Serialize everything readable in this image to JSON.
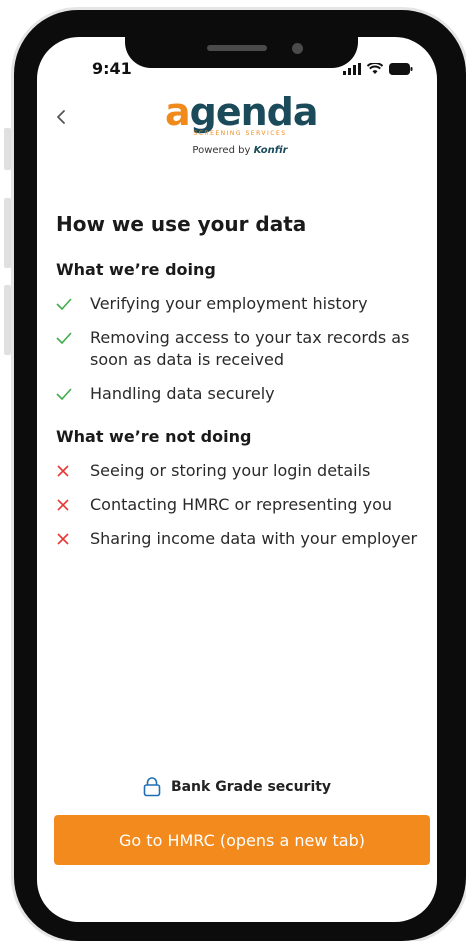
{
  "status_bar": {
    "time": "9:41"
  },
  "header": {
    "logo_word": "genda",
    "logo_letter": "a",
    "logo_subtitle": "SCREENING SERVICES",
    "powered_by": "Powered by",
    "powered_brand": "Konfir"
  },
  "page": {
    "title": "How we use your data"
  },
  "doing": {
    "heading": "What we’re doing",
    "items": [
      {
        "text": "Verifying your employment history"
      },
      {
        "text": "Removing access to your tax records as soon as data is received"
      },
      {
        "text": "Handling data securely"
      }
    ]
  },
  "not_doing": {
    "heading": "What we’re not doing",
    "items": [
      {
        "text": "Seeing or storing your login details"
      },
      {
        "text": "Contacting HMRC or representing you"
      },
      {
        "text": "Sharing income data with your employer"
      }
    ]
  },
  "footer": {
    "security_label": "Bank Grade security",
    "cta_label": "Go to HMRC (opens a new tab)"
  },
  "colors": {
    "accent": "#f28a1e",
    "check": "#3fae49",
    "cross": "#e53935",
    "brand_dark": "#1b4b5a"
  }
}
